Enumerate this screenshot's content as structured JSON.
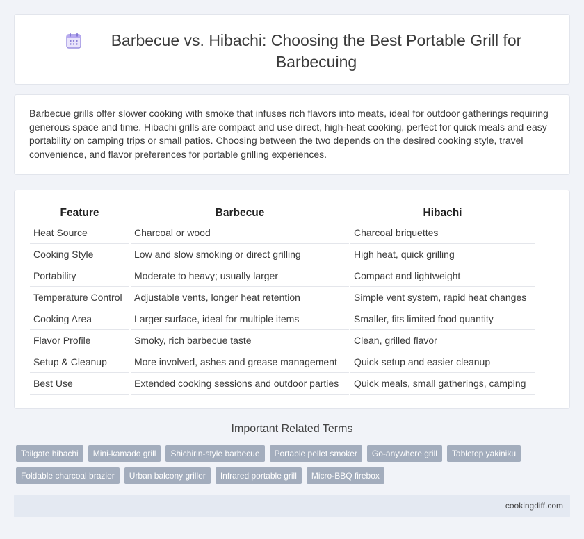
{
  "header": {
    "title": "Barbecue vs. Hibachi: Choosing the Best Portable Grill for Barbecuing",
    "icon": "calendar-icon"
  },
  "intro": {
    "text": "Barbecue grills offer slower cooking with smoke that infuses rich flavors into meats, ideal for outdoor gatherings requiring generous space and time. Hibachi grills are compact and use direct, high-heat cooking, perfect for quick meals and easy portability on camping trips or small patios. Choosing between the two depends on the desired cooking style, travel convenience, and flavor preferences for portable grilling experiences."
  },
  "table": {
    "headers": [
      "Feature",
      "Barbecue",
      "Hibachi"
    ],
    "rows": [
      [
        "Heat Source",
        "Charcoal or wood",
        "Charcoal briquettes"
      ],
      [
        "Cooking Style",
        "Low and slow smoking or direct grilling",
        "High heat, quick grilling"
      ],
      [
        "Portability",
        "Moderate to heavy; usually larger",
        "Compact and lightweight"
      ],
      [
        "Temperature Control",
        "Adjustable vents, longer heat retention",
        "Simple vent system, rapid heat changes"
      ],
      [
        "Cooking Area",
        "Larger surface, ideal for multiple items",
        "Smaller, fits limited food quantity"
      ],
      [
        "Flavor Profile",
        "Smoky, rich barbecue taste",
        "Clean, grilled flavor"
      ],
      [
        "Setup & Cleanup",
        "More involved, ashes and grease management",
        "Quick setup and easier cleanup"
      ],
      [
        "Best Use",
        "Extended cooking sessions and outdoor parties",
        "Quick meals, small gatherings, camping"
      ]
    ]
  },
  "related": {
    "title": "Important Related Terms",
    "tags_row1": [
      "Tailgate hibachi",
      "Mini-kamado grill",
      "Shichirin-style barbecue",
      "Portable pellet smoker",
      "Go-anywhere grill",
      "Tabletop yakiniku"
    ],
    "tags_row2": [
      "Foldable charcoal brazier",
      "Urban balcony griller",
      "Infrared portable grill",
      "Micro-BBQ firebox"
    ]
  },
  "footer": {
    "site": "cookingdiff.com"
  },
  "colors": {
    "background": "#f1f3f8",
    "tag": "#a3adbd",
    "footer": "#e4e9f2",
    "icon_accent": "#8b7fd6"
  }
}
